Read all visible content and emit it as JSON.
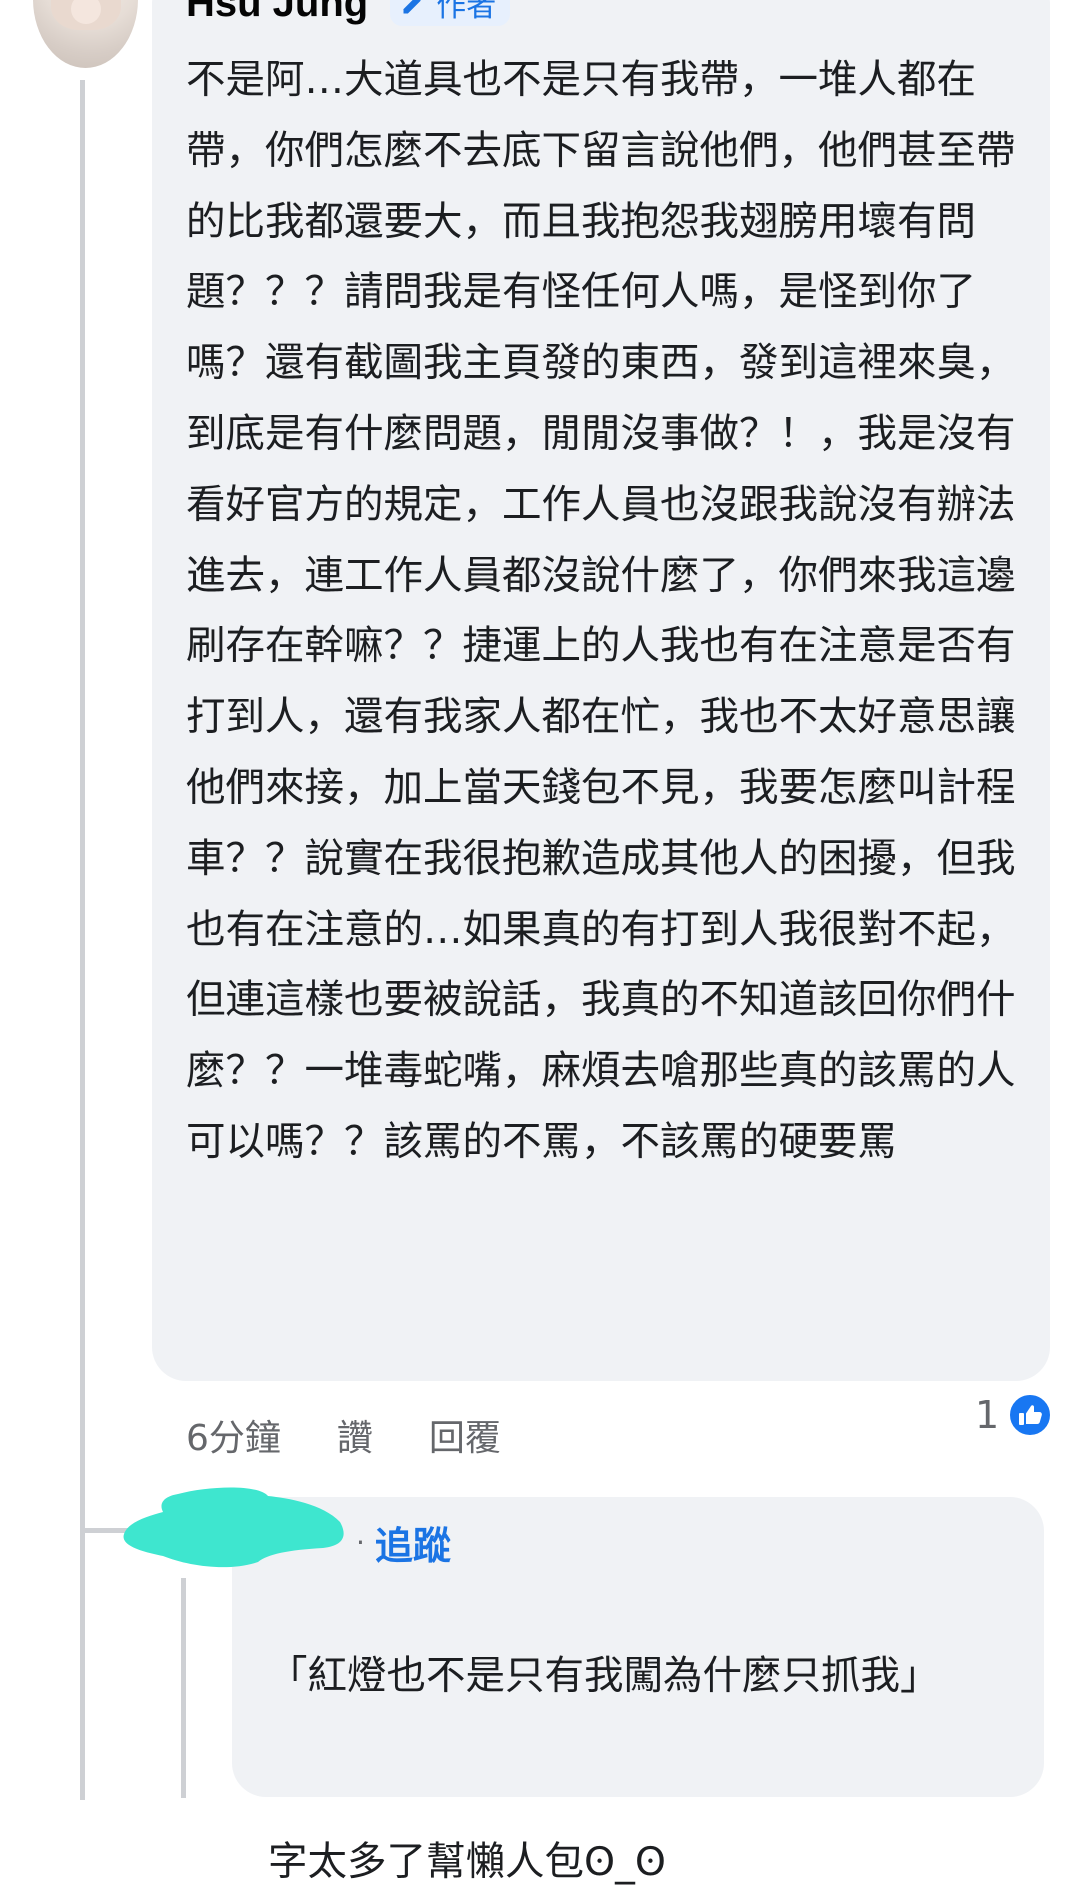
{
  "comment": {
    "author_name": "Hsu Jung",
    "author_badge": "作者",
    "text": "不是阿…大道具也不是只有我帶，一堆人都在帶，你們怎麼不去底下留言說他們，他們甚至帶的比我都還要大，而且我抱怨我翅膀用壞有問題？？？請問我是有怪任何人嗎，是怪到你了嗎？還有截圖我主頁發的東西，發到這裡來臭，到底是有什麼問題，閒閒沒事做？！，我是沒有看好官方的規定，工作人員也沒跟我說沒有辦法進去，連工作人員都沒說什麼了，你們來我這邊刷存在幹嘛？？捷運上的人我也有在注意是否有打到人，還有我家人都在忙，我也不太好意思讓他們來接，加上當天錢包不見，我要怎麼叫計程車？？說實在我很抱歉造成其他人的困擾，但我也有在注意的…如果真的有打到人我很對不起，但連這樣也要被說話，我真的不知道該回你們什麼？？一堆毒蛇嘴，麻煩去嗆那些真的該罵的人可以嗎？？該罵的不罵，不該罵的硬要罵",
    "timestamp": "6分鐘",
    "like_label": "讚",
    "reply_label": "回覆",
    "reaction_count": "1",
    "reaction_icon": "like-icon",
    "badge_icon": "pencil-icon"
  },
  "reply": {
    "separator": "·",
    "follow_label": "追蹤",
    "quote_line": "「紅燈也不是只有我闖為什麼只抓我」",
    "text_line": "字太多了幫懶人包ʘ_ʘ",
    "censor_color": "#3ee6cf"
  },
  "colors": {
    "bubble_bg": "#f0f2f5",
    "link_blue": "#1b74e4",
    "meta_gray": "#65676b",
    "thread_line": "#ced0d4"
  }
}
